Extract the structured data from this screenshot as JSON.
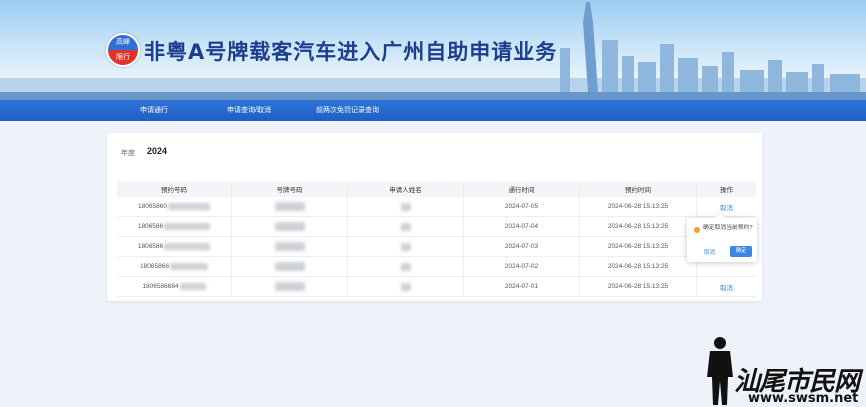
{
  "header": {
    "logo_top": "高峰",
    "logo_bottom": "限行",
    "title": "非粤A号牌载客汽车进入广州自助申请业务"
  },
  "nav": {
    "items": [
      "申请通行",
      "申请查询/取消",
      "前两次免罚记录查询"
    ]
  },
  "filter": {
    "year_label": "年度",
    "year_value": "2024"
  },
  "table": {
    "headers": [
      "预约号码",
      "号牌号码",
      "申请人姓名",
      "通行时间",
      "预约时间",
      "操作"
    ],
    "rows": [
      {
        "booking_no": "18065860",
        "travel_date": "2024-07-05",
        "booked_at": "2024-06-28 15:13:25",
        "action": "取消"
      },
      {
        "booking_no": "1806586",
        "travel_date": "2024-07-04",
        "booked_at": "2024-06-28 15:13:25",
        "action": ""
      },
      {
        "booking_no": "1806586",
        "travel_date": "2024-07-03",
        "booked_at": "2024-06-28 15:13:25",
        "action": ""
      },
      {
        "booking_no": "18065866",
        "travel_date": "2024-07-02",
        "booked_at": "2024-06-28 15:13:25",
        "action": ""
      },
      {
        "booking_no": "1806586684",
        "travel_date": "2024-07-01",
        "booked_at": "2024-06-28 15:13:25",
        "action": "取消"
      }
    ]
  },
  "popover": {
    "message": "确定取消当前预约?",
    "cancel": "取消",
    "confirm": "确定"
  },
  "watermark": {
    "text": "汕尾市民网",
    "url": "www.swsm.net"
  }
}
